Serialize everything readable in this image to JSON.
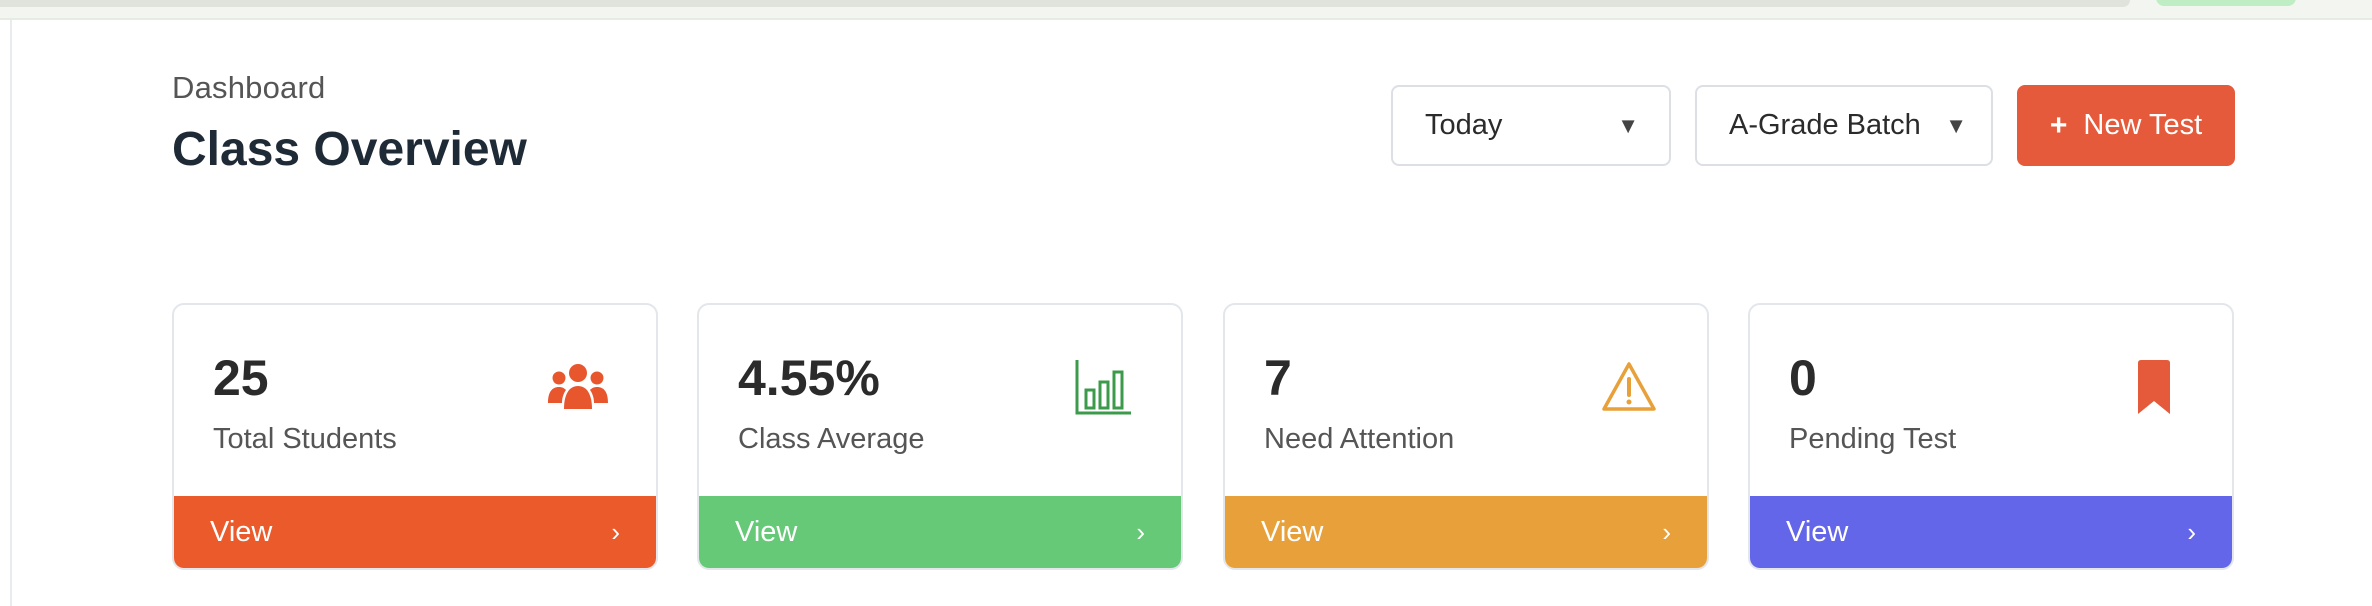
{
  "header": {
    "breadcrumb": "Dashboard",
    "title": "Class Overview"
  },
  "filters": {
    "date": {
      "selected": "Today",
      "icon": "caret-down-icon"
    },
    "batch": {
      "selected": "A-Grade Batch",
      "icon": "caret-down-icon"
    }
  },
  "actions": {
    "new_test": {
      "plus": "+",
      "label": "New Test",
      "color": "#e45a3a"
    }
  },
  "cards": [
    {
      "value": "25",
      "label": "Total Students",
      "icon": "users-icon",
      "icon_color": "#e8562e",
      "footer_label": "View",
      "chevron": "›",
      "footer_color": "#eb5a2b"
    },
    {
      "value": "4.55%",
      "label": "Class Average",
      "icon": "bar-chart-icon",
      "icon_color": "#3c9a4b",
      "footer_label": "View",
      "chevron": "›",
      "footer_color": "#66c977"
    },
    {
      "value": "7",
      "label": "Need Attention",
      "icon": "warning-icon",
      "icon_color": "#e8a13a",
      "footer_label": "View",
      "chevron": "›",
      "footer_color": "#e8a13a"
    },
    {
      "value": "0",
      "label": "Pending Test",
      "icon": "bookmark-icon",
      "icon_color": "#e45a3a",
      "footer_label": "View",
      "chevron": "›",
      "footer_color": "#6366e8"
    }
  ]
}
